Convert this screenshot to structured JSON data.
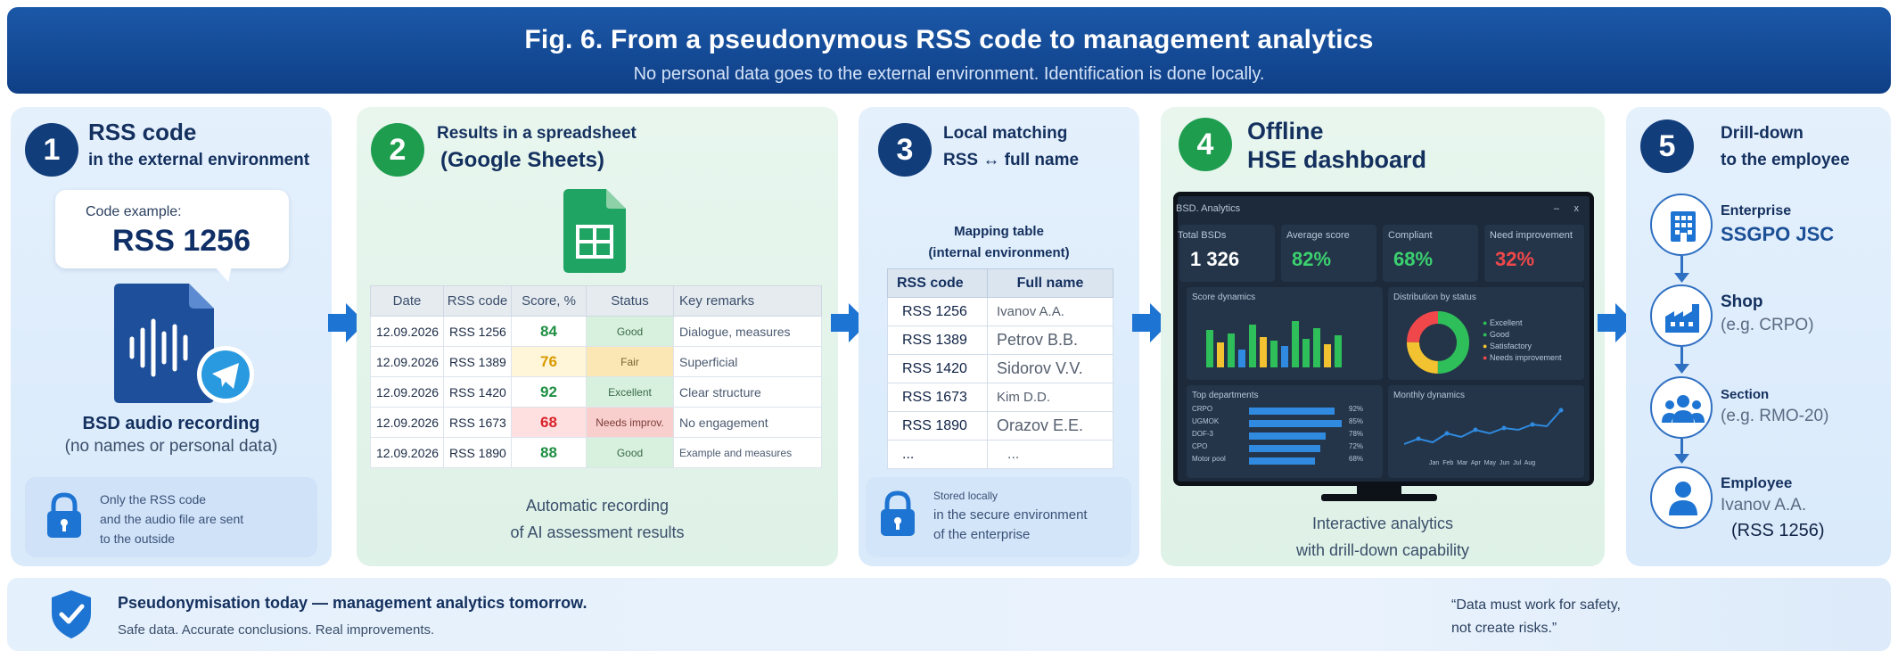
{
  "header": {
    "title": "Fig. 6. From a pseudonymous RSS code to management analytics",
    "subtitle": "No personal data goes to the external environment. Identification is done locally."
  },
  "step1": {
    "number": "1",
    "title_line1": "RSS code",
    "title_line2": "in the external environment",
    "example_label": "Code example:",
    "example_code": "RSS 1256",
    "audio_title": "BSD audio recording",
    "audio_note": "(no names or personal data)",
    "lock_line1": "Only the RSS code",
    "lock_line2": "and the audio file are sent",
    "lock_line3": "to the outside"
  },
  "step2": {
    "number": "2",
    "title_line1": "Results in a spreadsheet",
    "title_line2": "(Google Sheets)",
    "columns": [
      "Date",
      "RSS code",
      "Score, %",
      "Status",
      "Key remarks"
    ],
    "rows": [
      {
        "date": "12.09.2026",
        "code": "RSS 1256",
        "score": "84",
        "status": "Good",
        "remark": "Dialogue, measures"
      },
      {
        "date": "12.09.2026",
        "code": "RSS 1389",
        "score": "76",
        "status": "Fair",
        "remark": "Superficial"
      },
      {
        "date": "12.09.2026",
        "code": "RSS 1420",
        "score": "92",
        "status": "Excellent",
        "remark": "Clear structure"
      },
      {
        "date": "12.09.2026",
        "code": "RSS 1673",
        "score": "68",
        "status": "Needs improv.",
        "remark": "No engagement"
      },
      {
        "date": "12.09.2026",
        "code": "RSS 1890",
        "score": "88",
        "status": "Good",
        "remark": "Example and measures"
      }
    ],
    "caption_line1": "Automatic recording",
    "caption_line2": "of AI assessment results"
  },
  "step3": {
    "number": "3",
    "title_line1": "Local matching",
    "title_line2": "RSS ↔ full name",
    "table_title_line1": "Mapping table",
    "table_title_line2": "(internal environment)",
    "columns": [
      "RSS code",
      "Full name"
    ],
    "rows": [
      {
        "code": "RSS 1256",
        "name": "Ivanov A.A."
      },
      {
        "code": "RSS 1389",
        "name": "Petrov B.B."
      },
      {
        "code": "RSS 1420",
        "name": "Sidorov V.V."
      },
      {
        "code": "RSS 1673",
        "name": "Kim D.D."
      },
      {
        "code": "RSS 1890",
        "name": "Orazov E.E."
      },
      {
        "code": "...",
        "name": "..."
      }
    ],
    "lock_line1": "Stored locally",
    "lock_line2": "in the secure environment",
    "lock_line3": "of the enterprise"
  },
  "step4": {
    "number": "4",
    "title_line1": "Offline",
    "title_line2": "HSE dashboard",
    "dashboard": {
      "window_title": "BSD. Analytics",
      "close_glyph": "x",
      "kpis": [
        {
          "label": "Total BSDs",
          "value": "1 326",
          "color": "#ffffff"
        },
        {
          "label": "Average score",
          "value": "82%",
          "color": "#3bd16f"
        },
        {
          "label": "Compliant",
          "value": "68%",
          "color": "#3bd16f"
        },
        {
          "label": "Need improvement",
          "value": "32%",
          "color": "#f0484a"
        }
      ],
      "score_dynamics_title": "Score dynamics",
      "distribution_title": "Distribution by status",
      "distribution_legend": [
        "Excellent",
        "Good",
        "Satisfactory",
        "Needs improvement"
      ],
      "top_departments_title": "Top departments",
      "departments": [
        {
          "name": "CRPO",
          "value": "92%"
        },
        {
          "name": "UGMOK",
          "value": "85%"
        },
        {
          "name": "DOF-3",
          "value": "78%"
        },
        {
          "name": "CPO",
          "value": "72%"
        },
        {
          "name": "Motor pool",
          "value": "68%"
        }
      ],
      "monthly_title": "Monthly dynamics",
      "months": [
        "Jan",
        "Feb",
        "Mar",
        "Apr",
        "May",
        "Jun",
        "Jul",
        "Aug"
      ]
    },
    "caption_line1": "Interactive analytics",
    "caption_line2": "with drill-down capability"
  },
  "step5": {
    "number": "5",
    "title_line1": "Drill-down",
    "title_line2": "to the employee",
    "levels": [
      {
        "label": "Enterprise",
        "value": "SSGPO JSC"
      },
      {
        "label": "Shop",
        "value": "(e.g. CRPO)"
      },
      {
        "label": "Section",
        "value": "(e.g. RMO-20)"
      },
      {
        "label": "Employee",
        "value": "Ivanov A.A.",
        "extra": "(RSS 1256)"
      }
    ]
  },
  "footer": {
    "headline": "Pseudonymisation today — management analytics tomorrow.",
    "subline": "Safe data. Accurate conclusions. Real improvements.",
    "quote_line1": "“Data must work for safety,",
    "quote_line2": "not create risks.”"
  },
  "colors": {
    "navy": "#123d7b",
    "accent_blue": "#1e74d2",
    "green": "#1f9d4f",
    "score_good": "#1f8f43",
    "score_fair": "#d89a00",
    "score_bad": "#d9232a"
  }
}
